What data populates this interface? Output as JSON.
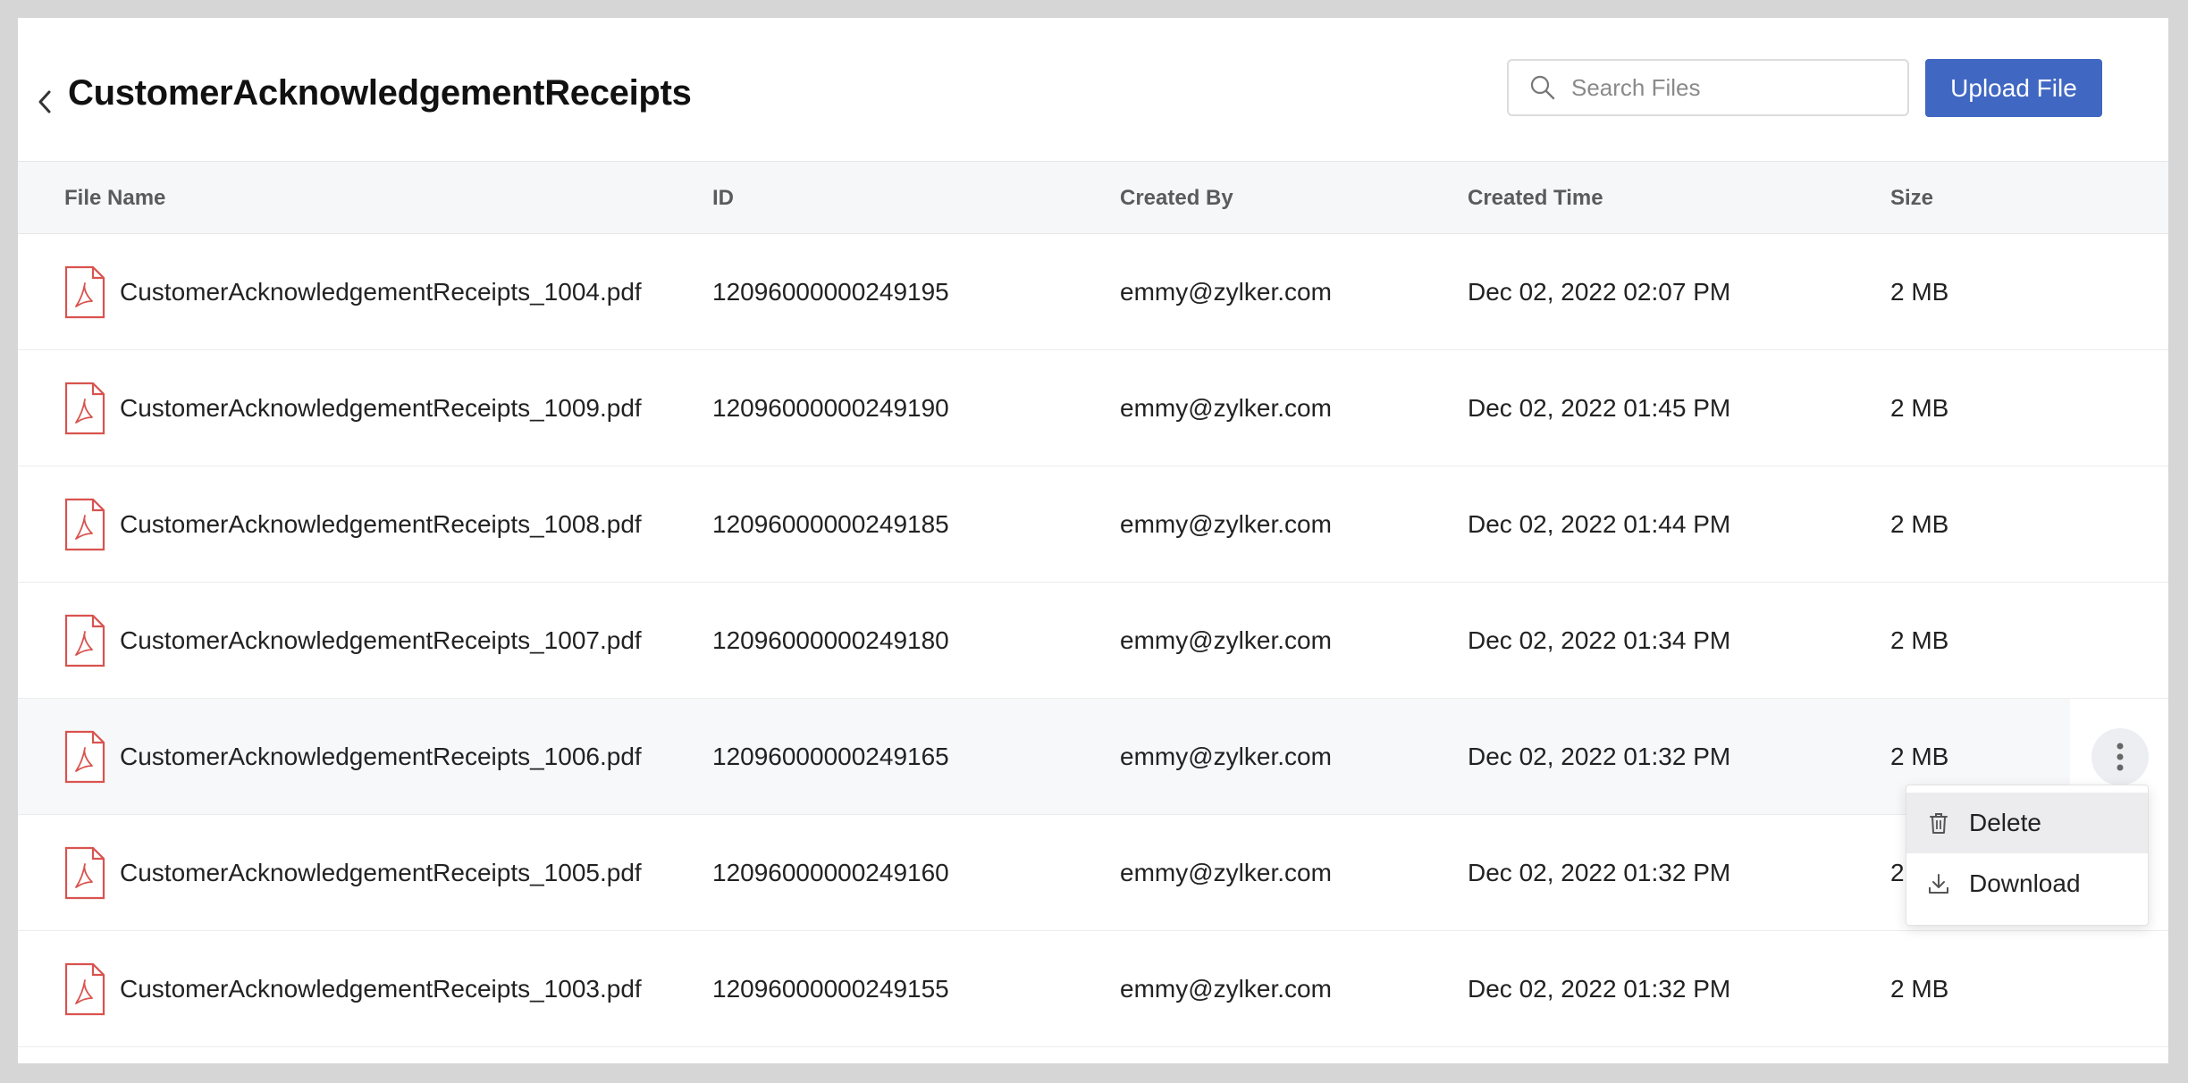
{
  "header": {
    "title": "CustomerAcknowledgementReceipts",
    "search_placeholder": "Search Files",
    "upload_label": "Upload File"
  },
  "table": {
    "columns": [
      "File Name",
      "ID",
      "Created By",
      "Created Time",
      "Size"
    ],
    "rows": [
      {
        "name": "CustomerAcknowledgementReceipts_1004.pdf",
        "id": "12096000000249195",
        "created_by": "emmy@zylker.com",
        "created_time": "Dec 02, 2022 02:07 PM",
        "size": "2 MB"
      },
      {
        "name": "CustomerAcknowledgementReceipts_1009.pdf",
        "id": "12096000000249190",
        "created_by": "emmy@zylker.com",
        "created_time": "Dec 02, 2022 01:45 PM",
        "size": "2 MB"
      },
      {
        "name": "CustomerAcknowledgementReceipts_1008.pdf",
        "id": "12096000000249185",
        "created_by": "emmy@zylker.com",
        "created_time": "Dec 02, 2022 01:44 PM",
        "size": "2 MB"
      },
      {
        "name": "CustomerAcknowledgementReceipts_1007.pdf",
        "id": "12096000000249180",
        "created_by": "emmy@zylker.com",
        "created_time": "Dec 02, 2022 01:34 PM",
        "size": "2 MB"
      },
      {
        "name": "CustomerAcknowledgementReceipts_1006.pdf",
        "id": "12096000000249165",
        "created_by": "emmy@zylker.com",
        "created_time": "Dec 02, 2022 01:32 PM",
        "size": "2 MB"
      },
      {
        "name": "CustomerAcknowledgementReceipts_1005.pdf",
        "id": "12096000000249160",
        "created_by": "emmy@zylker.com",
        "created_time": "Dec 02, 2022 01:32 PM",
        "size": "2"
      },
      {
        "name": "CustomerAcknowledgementReceipts_1003.pdf",
        "id": "12096000000249155",
        "created_by": "emmy@zylker.com",
        "created_time": "Dec 02, 2022 01:32 PM",
        "size": "2 MB"
      }
    ]
  },
  "context_menu": {
    "delete_label": "Delete",
    "download_label": "Download"
  },
  "icons": {
    "back": "chevron-left-icon",
    "search": "search-icon",
    "file": "pdf-file-icon",
    "more": "more-vertical-icon",
    "delete": "trash-icon",
    "download": "download-icon"
  },
  "colors": {
    "accent": "#4067c2",
    "pdf_red": "#d9534f",
    "header_bg": "#f6f7f9"
  }
}
